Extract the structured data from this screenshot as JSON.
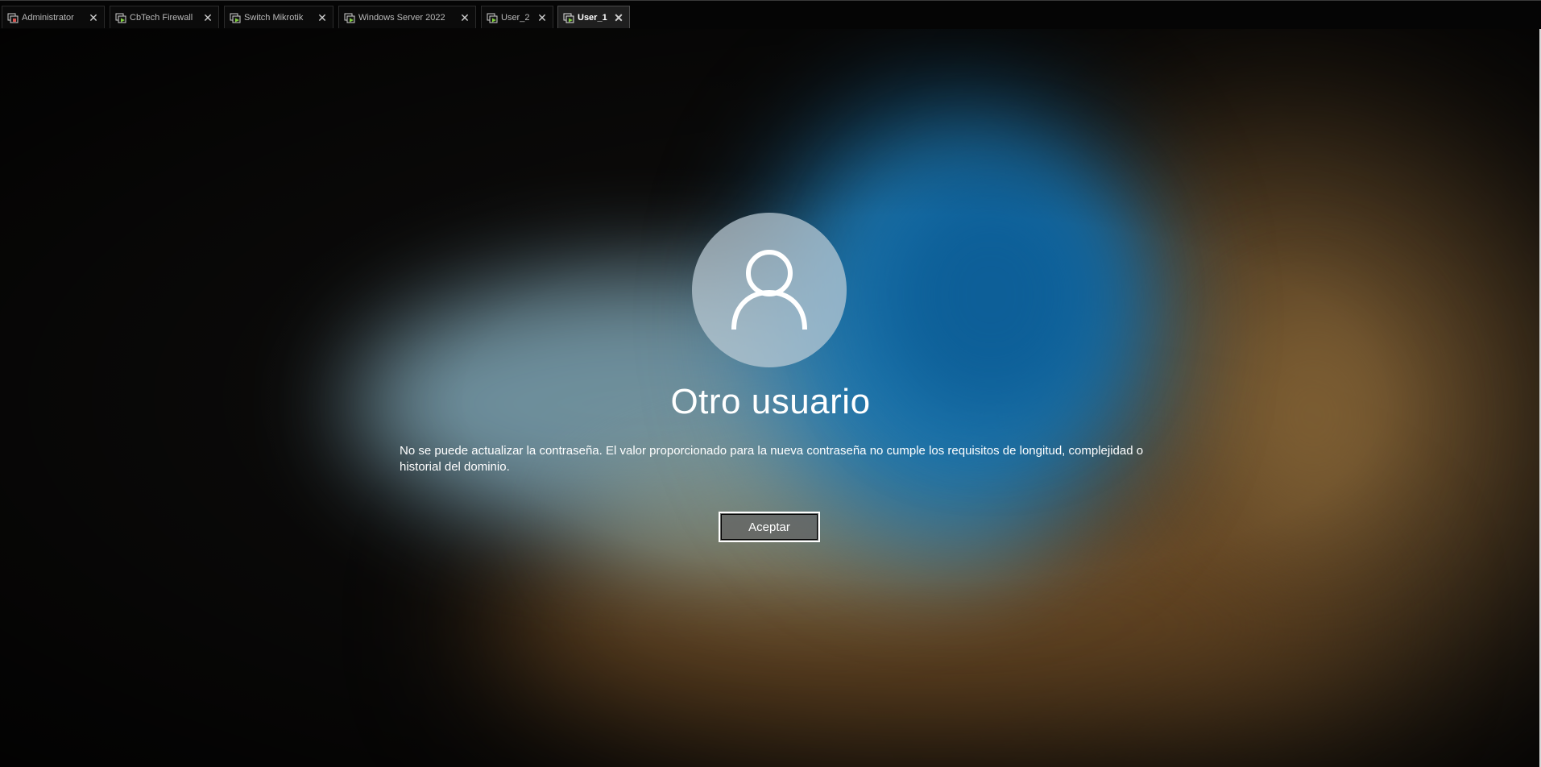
{
  "tabs": [
    {
      "label": "Administrator",
      "icon": "vm-stopped-icon",
      "icon_color": "#d9534f",
      "active": false
    },
    {
      "label": "CbTech Firewall",
      "icon": "vm-running-icon",
      "icon_color": "#7fd13b",
      "active": false
    },
    {
      "label": "Switch Mikrotik",
      "icon": "vm-running-icon",
      "icon_color": "#7fd13b",
      "active": false
    },
    {
      "label": "Windows Server 2022",
      "icon": "vm-running-icon",
      "icon_color": "#7fd13b",
      "active": false
    },
    {
      "label": "User_2",
      "icon": "vm-running-icon",
      "icon_color": "#7fd13b",
      "active": false
    },
    {
      "label": "User_1",
      "icon": "vm-running-icon",
      "icon_color": "#7fd13b",
      "active": true
    }
  ],
  "lock_screen": {
    "avatar_icon": "user-icon",
    "username": "Otro usuario",
    "message": "No se puede actualizar la contraseña. El valor proporcionado para la nueva contraseña no cumple los requisitos de longitud, complejidad o historial del dominio.",
    "button_label": "Aceptar"
  },
  "colors": {
    "tabbar_bg": "#050505",
    "active_tab_bg": "#1f1f1f",
    "text": "#ffffff"
  }
}
